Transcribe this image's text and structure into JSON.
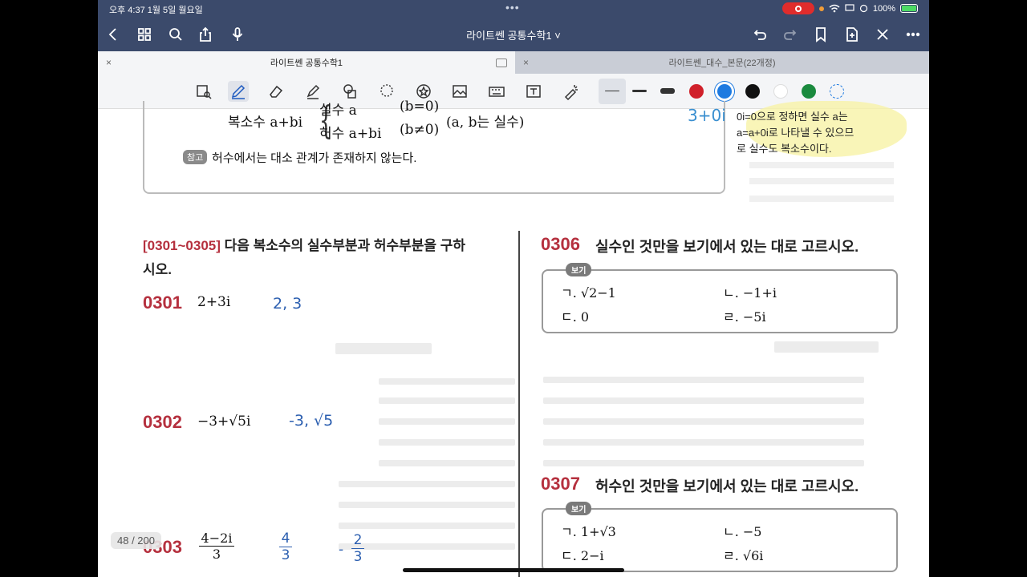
{
  "status_bar": {
    "time": "오후 4:37  1월 5일 월요일",
    "battery": "100%"
  },
  "nav": {
    "doc_title": "라이트쎈 공통수학1 ˅"
  },
  "tabs": [
    {
      "label": "라이트쎈 공통수학1"
    },
    {
      "label": "라이트쎈_대수_본문(22개정)"
    }
  ],
  "colors": {
    "red": "#d0202a",
    "blue": "#1e7ae0",
    "black": "#111111",
    "white": "#ffffff",
    "green": "#1a8a3e"
  },
  "top_box": {
    "lhs": "복소수 a+bi",
    "real_row": "실수 a",
    "real_cond": "(b=0)",
    "imag_row": "허수 a+bi",
    "imag_cond": "(b≠0)",
    "ab_note": "(a, b는 실수)",
    "ref_tag": "참고",
    "ref_text": "허수에서는 대소 관계가 존재하지 않는다."
  },
  "side_note": {
    "line1": "0i=0으로 정하면 실수 a는",
    "line2": "a=a+0i로 나타낼 수 있으므",
    "line3": "로 실수도 복소수이다.",
    "margin_scribble": "3+0i"
  },
  "left_column": {
    "range": "[0301~0305]",
    "instruction": "다음 복소수의 실수부분과 허수부분을 구하",
    "instruction2": "시오.",
    "problems": [
      {
        "num": "0301",
        "expr": "2+3i",
        "answer": "2, 3"
      },
      {
        "num": "0302",
        "expr": "−3+√5i",
        "answer": "-3, √5"
      },
      {
        "num": "0303",
        "expr_num": "4−2i",
        "expr_den": "3",
        "ans1_num": "4",
        "ans1_den": "3",
        "ans2_sign": "-",
        "ans2_num": "2",
        "ans2_den": "3"
      }
    ]
  },
  "right_column": {
    "p0306": {
      "num": "0306",
      "text": "실수인 것만을 보기에서 있는 대로 고르시오.",
      "bogi_label": "보기",
      "items": [
        "ㄱ. √2−1",
        "ㄴ. −1+i",
        "ㄷ. 0",
        "ㄹ. −5i"
      ]
    },
    "p0307": {
      "num": "0307",
      "text": "허수인 것만을 보기에서 있는 대로 고르시오.",
      "bogi_label": "보기",
      "items": [
        "ㄱ. 1+√3",
        "ㄴ. −5",
        "ㄷ. 2−i",
        "ㄹ. √6i"
      ]
    }
  },
  "page_indicator": "48 / 200"
}
